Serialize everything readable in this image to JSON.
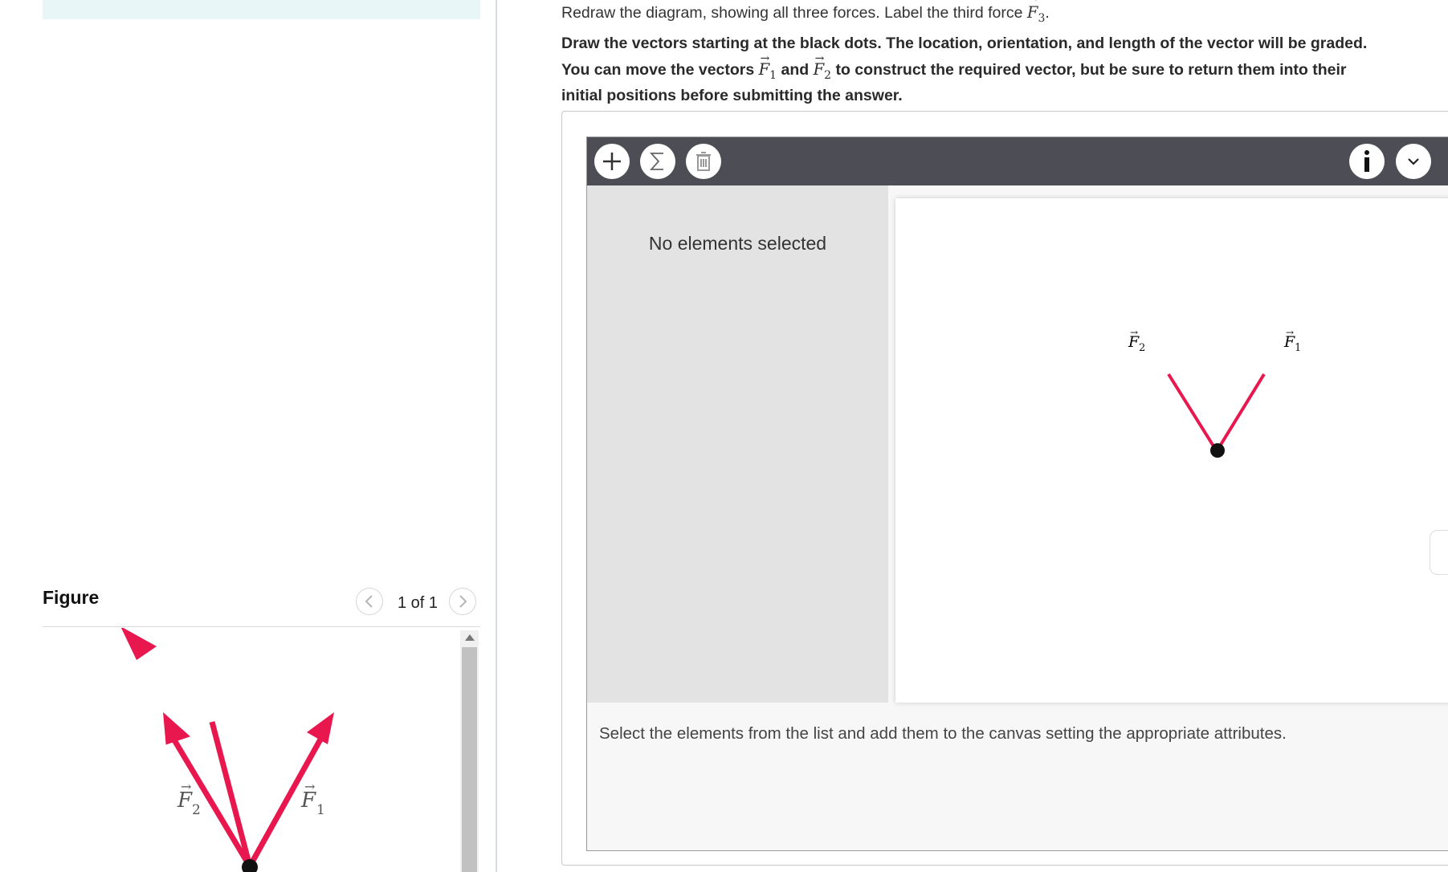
{
  "figure_panel": {
    "title": "Figure",
    "pager": "1 of 1",
    "labels": {
      "f2": "F",
      "f2_sub": "2",
      "f1": "F",
      "f1_sub": "1"
    }
  },
  "question": {
    "instruction_prefix": "Redraw the diagram, showing all three forces. Label the third force",
    "instruction_vec": "F",
    "instruction_vec_sub": "3",
    "instruction_suffix": ".",
    "bold_line1": "Draw the vectors starting at the black dots. The location, orientation, and length of the vector will be graded.",
    "bold_line2_a": "You can move the vectors",
    "bold_vec1": "F",
    "bold_vec1_sub": "1",
    "bold_line2_and": "and",
    "bold_vec2": "F",
    "bold_vec2_sub": "2",
    "bold_line2_b": "to construct the required vector, but be sure to return them into their initial positions before submitting the answer."
  },
  "tool": {
    "no_selection": "No elements selected",
    "hint": "Select the elements from the list and add them to the canvas setting the appropriate attributes.",
    "canvas_labels": {
      "f2": "F",
      "f2_sub": "2",
      "f1": "F",
      "f1_sub": "1"
    },
    "icons": [
      "plus-icon",
      "sigma-icon",
      "trash-icon",
      "info-icon",
      "chevron-down-icon"
    ]
  },
  "colors": {
    "vector": "#e8184f",
    "toolbar": "#4d4d56",
    "intro_bg": "#e9f6f7"
  }
}
